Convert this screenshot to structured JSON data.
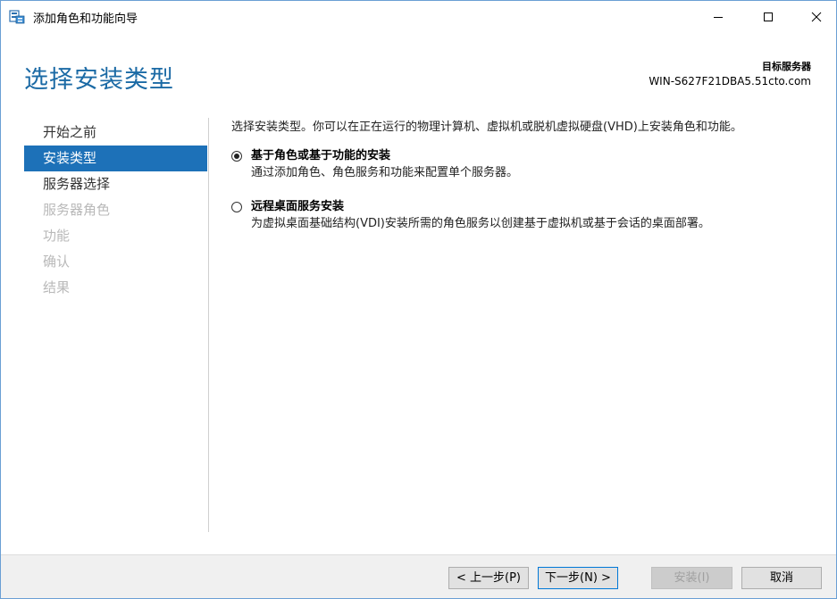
{
  "window": {
    "title": "添加角色和功能向导",
    "icon": "server-manager-icon"
  },
  "header": {
    "page_title": "选择安装类型",
    "target_label": "目标服务器",
    "target_server": "WIN-S627F21DBA5.51cto.com"
  },
  "nav": {
    "items": [
      {
        "label": "开始之前",
        "state": "normal"
      },
      {
        "label": "安装类型",
        "state": "active"
      },
      {
        "label": "服务器选择",
        "state": "normal"
      },
      {
        "label": "服务器角色",
        "state": "disabled"
      },
      {
        "label": "功能",
        "state": "disabled"
      },
      {
        "label": "确认",
        "state": "disabled"
      },
      {
        "label": "结果",
        "state": "disabled"
      }
    ]
  },
  "content": {
    "intro": "选择安装类型。你可以在正在运行的物理计算机、虚拟机或脱机虚拟硬盘(VHD)上安装角色和功能。",
    "options": [
      {
        "label": "基于角色或基于功能的安装",
        "desc": "通过添加角色、角色服务和功能来配置单个服务器。",
        "checked": true
      },
      {
        "label": "远程桌面服务安装",
        "desc": "为虚拟桌面基础结构(VDI)安装所需的角色服务以创建基于虚拟机或基于会话的桌面部署。",
        "checked": false
      }
    ]
  },
  "footer": {
    "prev_label": "< 上一步(P)",
    "next_label": "下一步(N) >",
    "install_label": "安装(I)",
    "cancel_label": "取消"
  },
  "colors": {
    "accent": "#1d71b8",
    "title_blue": "#1b6aa5",
    "disabled_text": "#b9b9b9"
  }
}
